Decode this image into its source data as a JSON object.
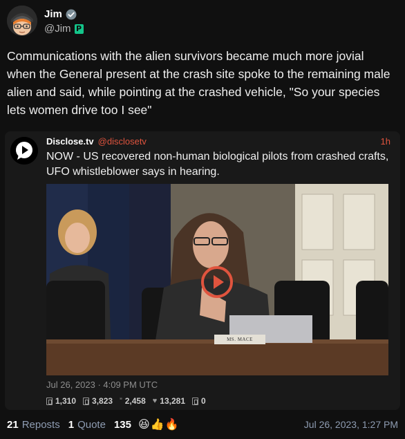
{
  "author": {
    "display_name": "Jim",
    "handle": "@Jim",
    "avatar_icon": "cartoon-avatar-icon",
    "verified_icon": "verified-check-icon",
    "badge_icon": "p-badge-icon",
    "badge_letter": "P"
  },
  "post": {
    "text": "Communications with the alien survivors became much more jovial when the General present at the crash site spoke to the remaining male alien and said, while pointing at the crashed vehicle, \"So your species lets women drive too I see\""
  },
  "quoted": {
    "display_name": "Disclose.tv",
    "handle": "@disclosetv",
    "time_ago": "1h",
    "text": "NOW - US recovered non-human biological pilots from crashed crafts, UFO whistleblower says in hearing.",
    "nameplate": "MS. MACE",
    "date": "Jul 26, 2023 · 4:09 PM UTC",
    "stats": {
      "replies": "1,310",
      "retweets": "3,823",
      "quotes": "2,458",
      "likes": "13,281",
      "bookmarks": "0"
    },
    "stat_quote_glyph": "”",
    "stat_like_glyph": "♥"
  },
  "footer": {
    "reposts_count": "21",
    "reposts_label": "Reposts",
    "quotes_count": "1",
    "quotes_label": "Quote",
    "reactions_count": "135",
    "reaction_emojis": [
      "😆",
      "👍",
      "🔥"
    ],
    "timestamp": "Jul 26, 2023, 1:27 PM"
  },
  "colors": {
    "background": "#101010",
    "card": "#191919",
    "accent_red": "#e0543e",
    "muted_blue": "#8e9cb2",
    "verified": "#7d8f99",
    "badge_green": "#14c58a"
  }
}
